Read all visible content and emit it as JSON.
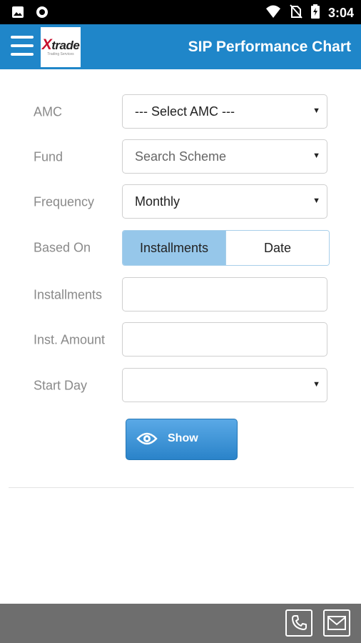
{
  "status_bar": {
    "time": "3:04"
  },
  "app_bar": {
    "title": "SIP Performance Chart",
    "logo_text": "trade",
    "logo_x": "X",
    "logo_tagline": "Trading Services"
  },
  "form": {
    "amc": {
      "label": "AMC",
      "value": "--- Select AMC ---"
    },
    "fund": {
      "label": "Fund",
      "value": "Search Scheme"
    },
    "frequency": {
      "label": "Frequency",
      "value": "Monthly"
    },
    "based_on": {
      "label": "Based On",
      "options": [
        "Installments",
        "Date"
      ],
      "selected": "Installments"
    },
    "installments": {
      "label": "Installments",
      "value": ""
    },
    "inst_amount": {
      "label": "Inst. Amount",
      "value": ""
    },
    "start_day": {
      "label": "Start Day",
      "value": ""
    }
  },
  "show_button": {
    "label": "Show"
  },
  "colors": {
    "primary": "#1f86c9",
    "segment_active": "#96c7ea",
    "bottom_bar": "#6e6e6e"
  },
  "icons": [
    "image-icon",
    "circle-icon",
    "wifi-icon",
    "no-sim-icon",
    "battery-charging-icon",
    "menu-icon",
    "eye-icon",
    "phone-icon",
    "mail-icon"
  ]
}
